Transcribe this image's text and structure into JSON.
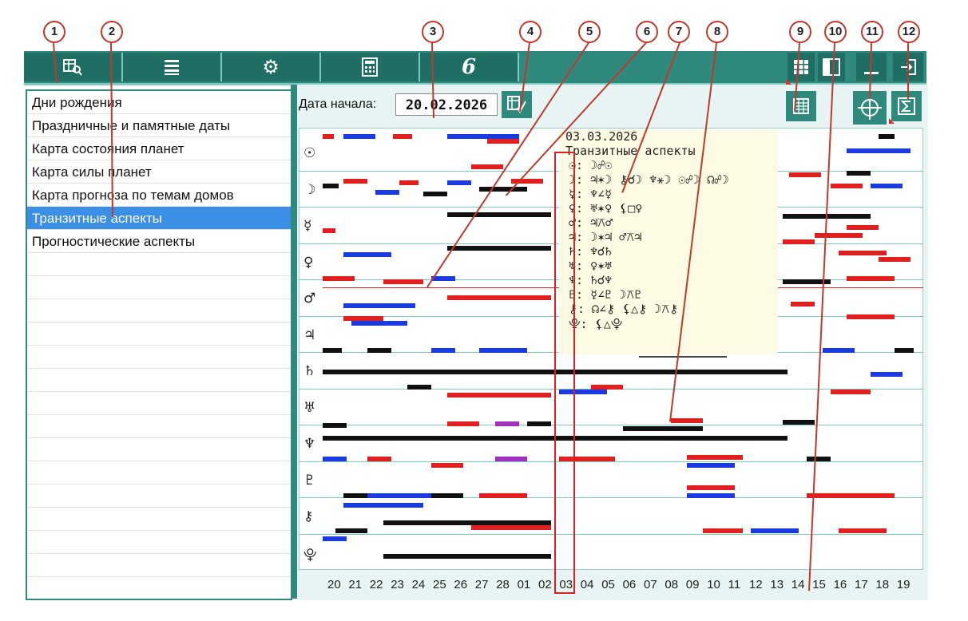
{
  "callouts": [
    "1",
    "2",
    "3",
    "4",
    "5",
    "6",
    "7",
    "8",
    "9",
    "10",
    "11",
    "12"
  ],
  "toolbar": {
    "icons": [
      "chart-search-icon",
      "list-icon",
      "gear-icon",
      "calculator-icon",
      "logo-icon"
    ],
    "right_icons": [
      "grid-icon",
      "panel-icon",
      "minimize-icon",
      "exit-icon"
    ]
  },
  "sidebar": {
    "items": [
      {
        "label": "Дни рождения"
      },
      {
        "label": "Праздничные и памятные даты"
      },
      {
        "label": "Карта состояния планет"
      },
      {
        "label": "Карта силы планет"
      },
      {
        "label": "Карта прогноза по темам домов"
      },
      {
        "label": "Транзитные аспекты"
      },
      {
        "label": "Прогностические аспекты"
      }
    ],
    "selected_index": 5
  },
  "panel": {
    "date_label": "Дата начала:",
    "date_value": "20.02.2026"
  },
  "planets": [
    "☉",
    "☽",
    "☿",
    "♀",
    "♂",
    "♃",
    "♄",
    "♅",
    "♆",
    "♇",
    "⚷",
    "⯓"
  ],
  "dates": [
    "20",
    "21",
    "22",
    "23",
    "24",
    "25",
    "26",
    "27",
    "28",
    "01",
    "02",
    "03",
    "04",
    "05",
    "06",
    "07",
    "08",
    "09",
    "10",
    "11",
    "12",
    "13",
    "14",
    "15",
    "16",
    "17",
    "18",
    "19"
  ],
  "popup": {
    "date": "03.03.2026",
    "title": "Транзитные аспекты",
    "lines": [
      "☉:  ☽☍☉",
      "☽:  ♃✶☽  ⚷☌☽  ♆⚹☽  ☉☍☽  ☊☍☽",
      "☿:  ♆∠☿",
      "♀:  ♅✶♀  ⚸□♀",
      "♂:  ♃⚻♂",
      "♃:  ☽✶♃  ♂⚻♃",
      "♄:  ♆☌♄",
      "♅:  ♀✶♅",
      "♆:  ♄☌♆",
      "♇:  ☿∠♇  ☽⚻♇",
      "⚷:  ☊∠⚷  ⚸△⚷  ☽⚻⚷",
      "⯓:  ⚸△⯓"
    ]
  },
  "colors": {
    "teal": "#2f8a7d",
    "red": "#e02020",
    "blue": "#1a3ae0",
    "black": "#111111",
    "purple": "#a030c0",
    "select": "#3b8fe4"
  }
}
